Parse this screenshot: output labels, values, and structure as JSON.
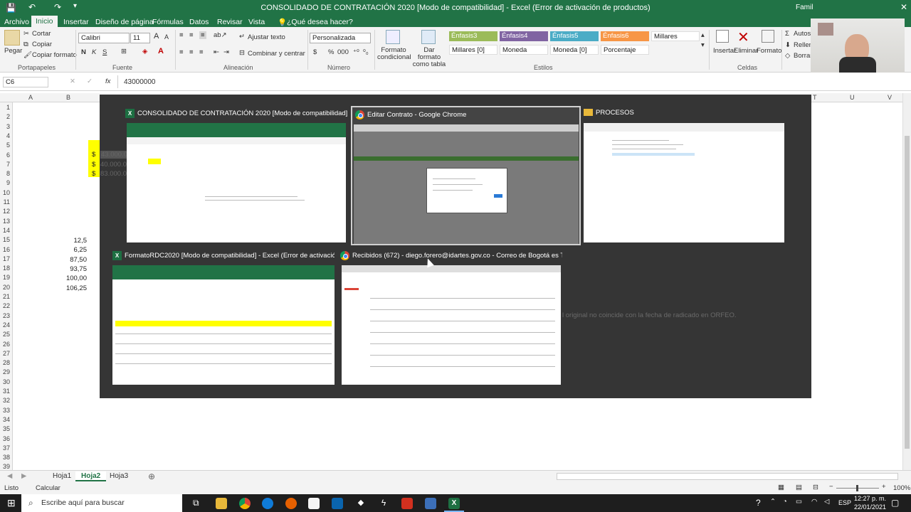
{
  "window": {
    "title": "CONSOLIDADO DE CONTRATACIÓN 2020  [Modo de compatibilidad] - Excel (Error de activación de productos)",
    "user_partial": "Famil"
  },
  "ribbon_tabs": [
    "Archivo",
    "Inicio",
    "Insertar",
    "Diseño de página",
    "Fórmulas",
    "Datos",
    "Revisar",
    "Vista"
  ],
  "tell_me": "¿Qué desea hacer?",
  "clipboard": {
    "paste": "Pegar",
    "cut": "Cortar",
    "copy": "Copiar",
    "format_painter": "Copiar formato",
    "group": "Portapapeles"
  },
  "font": {
    "name": "Calibri",
    "size": "11",
    "group": "Fuente",
    "bold": "N",
    "italic": "K",
    "underline": "S"
  },
  "alignment": {
    "wrap": "Ajustar texto",
    "merge": "Combinar y centrar",
    "group": "Alineación"
  },
  "number": {
    "format": "Personalizada",
    "currency": "$",
    "percent": "%",
    "thousands": "000",
    "group": "Número"
  },
  "styles": {
    "cond_format": "Formato condicional",
    "table_format": "Dar formato como tabla",
    "group": "Estilos",
    "cells": [
      {
        "label": "Énfasis3",
        "bg": "#9bbb59",
        "fg": "#ffffff"
      },
      {
        "label": "Énfasis4",
        "bg": "#8064a2",
        "fg": "#ffffff"
      },
      {
        "label": "Énfasis5",
        "bg": "#4bacc6",
        "fg": "#ffffff"
      },
      {
        "label": "Énfasis6",
        "bg": "#f79646",
        "fg": "#ffffff"
      },
      {
        "label": "Millares",
        "bg": "#ffffff",
        "fg": "#222222"
      },
      {
        "label": "Millares [0]",
        "bg": "#ffffff",
        "fg": "#222222"
      },
      {
        "label": "Moneda",
        "bg": "#ffffff",
        "fg": "#222222"
      },
      {
        "label": "Moneda [0]",
        "bg": "#ffffff",
        "fg": "#222222"
      },
      {
        "label": "Porcentaje",
        "bg": "#ffffff",
        "fg": "#222222"
      }
    ]
  },
  "cells_group": {
    "insert": "Insertar",
    "delete": "Eliminar",
    "format": "Formato",
    "group": "Celdas"
  },
  "editing": {
    "autosum": "Autosu",
    "fill": "Rellen",
    "clear": "Borrar"
  },
  "formula_bar": {
    "name_box": "C6",
    "fx": "fx",
    "value": "43000000"
  },
  "columns": [
    "A",
    "B",
    "C",
    "D",
    "E",
    "F",
    "G",
    "H",
    "I",
    "J",
    "K",
    "L",
    "M",
    "N",
    "O",
    "P",
    "Q",
    "R",
    "S",
    "T",
    "U",
    "V"
  ],
  "visible_columns": {
    "a": "A",
    "b": "B",
    "t": "T",
    "u": "U",
    "v": "V"
  },
  "rows": [
    "1",
    "2",
    "3",
    "4",
    "5",
    "6",
    "7",
    "8",
    "9",
    "10",
    "11",
    "12",
    "13",
    "14",
    "15",
    "16",
    "17",
    "18",
    "19",
    "20",
    "21",
    "22",
    "23",
    "24",
    "25",
    "26",
    "27",
    "28",
    "29",
    "30",
    "31",
    "32",
    "33",
    "34",
    "35",
    "36",
    "37",
    "38",
    "39"
  ],
  "cell_values": {
    "dollar": "$",
    "c6": "43.000.000",
    "c7": "40.000.000",
    "c8": "83.000.000",
    "b15": "12,5",
    "b16": "6,25",
    "b17": "87,50",
    "b18": "93,75",
    "b19": "100,00",
    "b20": "106,25",
    "note": "l original no coincide con la fecha de radicado en ORFEO."
  },
  "task_view": {
    "windows": [
      {
        "title": "CONSOLIDADO DE CONTRATACIÓN 2020  [Modo de compatibilidad] - Exce...",
        "icon": "excel-icon"
      },
      {
        "title": "Editar Contrato - Google Chrome",
        "icon": "chrome-icon"
      },
      {
        "title": "PROCESOS",
        "icon": "folder-icon"
      },
      {
        "title": "FormatoRDC2020  [Modo de compatibilidad] - Excel (Error de activación de...",
        "icon": "excel-icon"
      },
      {
        "title": "Recibidos (672) - diego.forero@idartes.gov.co - Correo de Bogotá es TIC - G...",
        "icon": "chrome-icon"
      }
    ]
  },
  "sheet_tabs": [
    "Hoja1",
    "Hoja2",
    "Hoja3"
  ],
  "active_sheet": "Hoja2",
  "status": {
    "mode": "Listo",
    "calc": "Calcular",
    "zoom": "100%"
  },
  "taskbar": {
    "search": "Escribe aquí para buscar",
    "lang": "ESP",
    "time": "12:27 p. m.",
    "date": "22/01/2021"
  }
}
